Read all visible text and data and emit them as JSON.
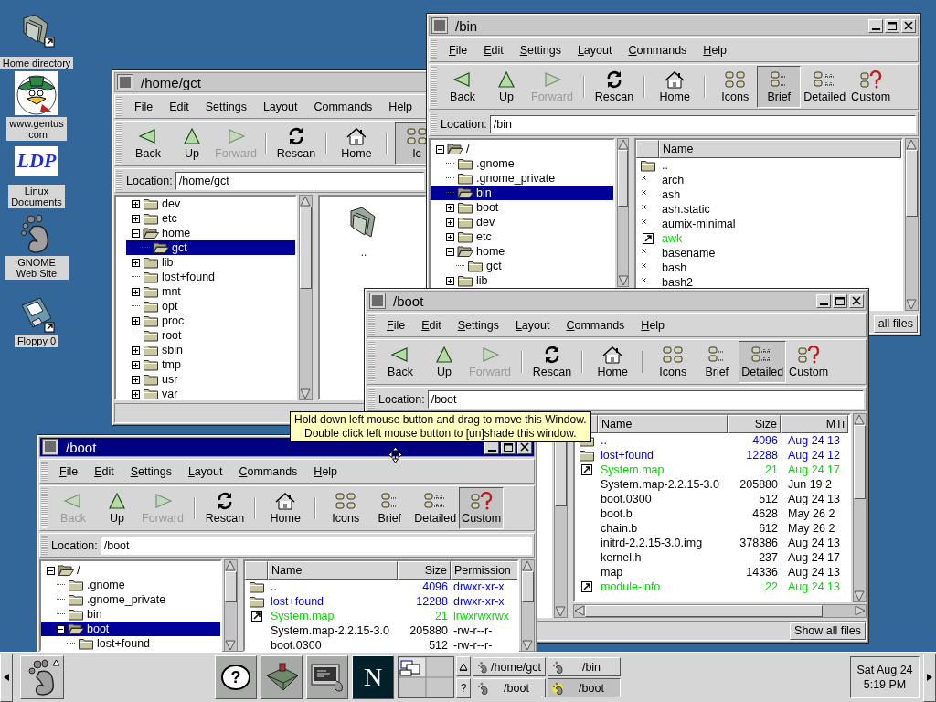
{
  "desktop_icons": [
    {
      "kind": "home-folder",
      "label": "Home directory"
    },
    {
      "kind": "cartoon",
      "label": "www.gentus.com"
    },
    {
      "kind": "logo",
      "logo_text": "LDP",
      "label": "Linux Documents"
    },
    {
      "kind": "foot",
      "label": "GNOME Web Site"
    },
    {
      "kind": "floppy",
      "label": "Floppy 0"
    }
  ],
  "windows": [
    {
      "title": "/home/gct",
      "active": false,
      "controls": false,
      "menu": [
        "File",
        "Edit",
        "Settings",
        "Layout",
        "Commands",
        "Help"
      ],
      "toolbar": [
        {
          "kind": "back",
          "label": "Back",
          "disabled": false,
          "selected": false
        },
        {
          "kind": "up",
          "label": "Up",
          "disabled": false,
          "selected": false
        },
        {
          "kind": "forward",
          "label": "Forward",
          "disabled": true,
          "selected": false
        },
        {
          "kind": "separator"
        },
        {
          "kind": "rescan",
          "label": "Rescan",
          "disabled": false,
          "selected": false
        },
        {
          "kind": "separator"
        },
        {
          "kind": "home",
          "label": "Home",
          "disabled": false,
          "selected": false
        },
        {
          "kind": "separator"
        },
        {
          "kind": "icons",
          "label": "Ic",
          "disabled": false,
          "selected": true
        }
      ],
      "location_label": "Location:",
      "location": "/home/gct",
      "tree": [
        {
          "label": "dev",
          "expandable": true,
          "expanded": false,
          "selected": false
        },
        {
          "label": "etc",
          "expandable": true,
          "expanded": false,
          "selected": false
        },
        {
          "label": "home",
          "expandable": true,
          "expanded": true,
          "selected": false,
          "children": [
            {
              "label": "gct",
              "expandable": false,
              "expanded": false,
              "selected": true
            }
          ]
        },
        {
          "label": "lib",
          "expandable": true,
          "expanded": false,
          "selected": false
        },
        {
          "label": "lost+found",
          "expandable": false,
          "expanded": false,
          "selected": false
        },
        {
          "label": "mnt",
          "expandable": true,
          "expanded": false,
          "selected": false
        },
        {
          "label": "opt",
          "expandable": false,
          "expanded": false,
          "selected": false
        },
        {
          "label": "proc",
          "expandable": true,
          "expanded": false,
          "selected": false
        },
        {
          "label": "root",
          "expandable": false,
          "expanded": false,
          "selected": false
        },
        {
          "label": "sbin",
          "expandable": true,
          "expanded": false,
          "selected": false
        },
        {
          "label": "tmp",
          "expandable": true,
          "expanded": false,
          "selected": false
        },
        {
          "label": "usr",
          "expandable": true,
          "expanded": false,
          "selected": false
        },
        {
          "label": "var",
          "expandable": true,
          "expanded": false,
          "selected": false
        }
      ],
      "list": {
        "kind": "icons",
        "items": [
          {
            "kind": "dir",
            "label": ".."
          }
        ]
      }
    },
    {
      "title": "/bin",
      "active": false,
      "controls": true,
      "menu": [
        "File",
        "Edit",
        "Settings",
        "Layout",
        "Commands",
        "Help"
      ],
      "toolbar": [
        {
          "kind": "back",
          "label": "Back",
          "disabled": false,
          "selected": false
        },
        {
          "kind": "up",
          "label": "Up",
          "disabled": false,
          "selected": false
        },
        {
          "kind": "forward",
          "label": "Forward",
          "disabled": true,
          "selected": false
        },
        {
          "kind": "separator"
        },
        {
          "kind": "rescan",
          "label": "Rescan",
          "disabled": false,
          "selected": false
        },
        {
          "kind": "separator"
        },
        {
          "kind": "home",
          "label": "Home",
          "disabled": false,
          "selected": false
        },
        {
          "kind": "separator"
        },
        {
          "kind": "icons",
          "label": "Icons",
          "disabled": false,
          "selected": false
        },
        {
          "kind": "brief",
          "label": "Brief",
          "disabled": false,
          "selected": true
        },
        {
          "kind": "detailed",
          "label": "Detailed",
          "disabled": false,
          "selected": false
        },
        {
          "kind": "custom",
          "label": "Custom",
          "disabled": false,
          "selected": false
        }
      ],
      "location_label": "Location:",
      "location": "/bin",
      "tree": [
        {
          "label": "/",
          "expandable": true,
          "expanded": true,
          "selected": false,
          "children": [
            {
              "label": ".gnome",
              "expandable": false,
              "expanded": false,
              "selected": false
            },
            {
              "label": ".gnome_private",
              "expandable": false,
              "expanded": false,
              "selected": false
            },
            {
              "label": "bin",
              "expandable": false,
              "expanded": false,
              "selected": true
            },
            {
              "label": "boot",
              "expandable": true,
              "expanded": false,
              "selected": false
            },
            {
              "label": "dev",
              "expandable": true,
              "expanded": false,
              "selected": false
            },
            {
              "label": "etc",
              "expandable": true,
              "expanded": false,
              "selected": false
            },
            {
              "label": "home",
              "expandable": true,
              "expanded": true,
              "selected": false,
              "children": [
                {
                  "label": "gct",
                  "expandable": false,
                  "expanded": false,
                  "selected": false
                }
              ]
            },
            {
              "label": "lib",
              "expandable": true,
              "expanded": false,
              "selected": false
            }
          ]
        }
      ],
      "list": {
        "kind": "brief",
        "columns": [
          {
            "kind": "name",
            "label": "Name"
          }
        ],
        "rows": [
          {
            "kind": "dir",
            "cells": [
              ".."
            ]
          },
          {
            "kind": "exec",
            "cells": [
              "arch"
            ]
          },
          {
            "kind": "exec",
            "cells": [
              "ash"
            ]
          },
          {
            "kind": "exec",
            "cells": [
              "ash.static"
            ]
          },
          {
            "kind": "exec",
            "cells": [
              "aumix-minimal"
            ]
          },
          {
            "kind": "link",
            "cells": [
              "awk"
            ]
          },
          {
            "kind": "exec",
            "cells": [
              "basename"
            ]
          },
          {
            "kind": "exec",
            "cells": [
              "bash"
            ]
          },
          {
            "kind": "exec",
            "cells": [
              "bash2"
            ]
          }
        ]
      },
      "status_button": "all files"
    },
    {
      "title": "/boot",
      "active": false,
      "controls": true,
      "menu": [
        "File",
        "Edit",
        "Settings",
        "Layout",
        "Commands",
        "Help"
      ],
      "toolbar": [
        {
          "kind": "back",
          "label": "Back",
          "disabled": false,
          "selected": false
        },
        {
          "kind": "up",
          "label": "Up",
          "disabled": false,
          "selected": false
        },
        {
          "kind": "forward",
          "label": "Forward",
          "disabled": true,
          "selected": false
        },
        {
          "kind": "separator"
        },
        {
          "kind": "rescan",
          "label": "Rescan",
          "disabled": false,
          "selected": false
        },
        {
          "kind": "separator"
        },
        {
          "kind": "home",
          "label": "Home",
          "disabled": false,
          "selected": false
        },
        {
          "kind": "separator"
        },
        {
          "kind": "icons",
          "label": "Icons",
          "disabled": false,
          "selected": false
        },
        {
          "kind": "brief",
          "label": "Brief",
          "disabled": false,
          "selected": false
        },
        {
          "kind": "detailed",
          "label": "Detailed",
          "disabled": false,
          "selected": true
        },
        {
          "kind": "custom",
          "label": "Custom",
          "disabled": false,
          "selected": false
        }
      ],
      "location_label": "Location:",
      "location": "/boot",
      "list": {
        "kind": "detailed",
        "columns": [
          {
            "kind": "name",
            "label": "Name"
          },
          {
            "kind": "size",
            "label": "Size"
          },
          {
            "kind": "mtime",
            "label": "MTi"
          }
        ],
        "rows": [
          {
            "kind": "dir",
            "cells": [
              "..",
              "4096",
              "Aug 24 13"
            ]
          },
          {
            "kind": "dir",
            "cells": [
              "lost+found",
              "12288",
              "Aug 24 12"
            ]
          },
          {
            "kind": "link",
            "cells": [
              "System.map",
              "21",
              "Aug 24 17"
            ]
          },
          {
            "kind": "file",
            "cells": [
              "System.map-2.2.15-3.0",
              "205880",
              "Jun 19 2"
            ]
          },
          {
            "kind": "file",
            "cells": [
              "boot.0300",
              "512",
              "Aug 24 13"
            ]
          },
          {
            "kind": "file",
            "cells": [
              "boot.b",
              "4628",
              "May 26 2"
            ]
          },
          {
            "kind": "file",
            "cells": [
              "chain.b",
              "612",
              "May 26 2"
            ]
          },
          {
            "kind": "file",
            "cells": [
              "initrd-2.2.15-3.0.img",
              "378386",
              "Aug 24 13"
            ]
          },
          {
            "kind": "file",
            "cells": [
              "kernel.h",
              "237",
              "Aug 24 17"
            ]
          },
          {
            "kind": "file",
            "cells": [
              "map",
              "14336",
              "Aug 24 13"
            ]
          },
          {
            "kind": "link",
            "cells": [
              "module-info",
              "22",
              "Aug 24 13"
            ]
          }
        ]
      },
      "status_button": "Show all files"
    },
    {
      "title": "/boot",
      "active": true,
      "controls": true,
      "menu": [
        "File",
        "Edit",
        "Settings",
        "Layout",
        "Commands",
        "Help"
      ],
      "toolbar": [
        {
          "kind": "back",
          "label": "Back",
          "disabled": true,
          "selected": false
        },
        {
          "kind": "up",
          "label": "Up",
          "disabled": false,
          "selected": false
        },
        {
          "kind": "forward",
          "label": "Forward",
          "disabled": true,
          "selected": false
        },
        {
          "kind": "separator"
        },
        {
          "kind": "rescan",
          "label": "Rescan",
          "disabled": false,
          "selected": false
        },
        {
          "kind": "separator"
        },
        {
          "kind": "home",
          "label": "Home",
          "disabled": false,
          "selected": false
        },
        {
          "kind": "separator"
        },
        {
          "kind": "icons",
          "label": "Icons",
          "disabled": false,
          "selected": false
        },
        {
          "kind": "brief",
          "label": "Brief",
          "disabled": false,
          "selected": false
        },
        {
          "kind": "detailed",
          "label": "Detailed",
          "disabled": false,
          "selected": false
        },
        {
          "kind": "custom",
          "label": "Custom",
          "disabled": false,
          "selected": true
        }
      ],
      "location_label": "Location:",
      "location": "/boot",
      "tree": [
        {
          "label": "/",
          "expandable": true,
          "expanded": true,
          "selected": false,
          "children": [
            {
              "label": ".gnome",
              "expandable": false,
              "expanded": false,
              "selected": false
            },
            {
              "label": ".gnome_private",
              "expandable": false,
              "expanded": false,
              "selected": false
            },
            {
              "label": "bin",
              "expandable": false,
              "expanded": false,
              "selected": false
            },
            {
              "label": "boot",
              "expandable": true,
              "expanded": true,
              "selected": true,
              "children": [
                {
                  "label": "lost+found",
                  "expandable": false,
                  "expanded": false,
                  "selected": false
                }
              ]
            }
          ]
        }
      ],
      "list": {
        "kind": "detailed",
        "columns": [
          {
            "kind": "name",
            "label": "Name"
          },
          {
            "kind": "size",
            "label": "Size"
          },
          {
            "kind": "permission",
            "label": "Permission"
          }
        ],
        "rows": [
          {
            "kind": "dir",
            "cells": [
              "..",
              "4096",
              "drwxr-xr-x"
            ]
          },
          {
            "kind": "dir",
            "cells": [
              "lost+found",
              "12288",
              "drwxr-xr-x"
            ]
          },
          {
            "kind": "link",
            "cells": [
              "System.map",
              "21",
              "lrwxrwxrwx"
            ]
          },
          {
            "kind": "file",
            "cells": [
              "System.map-2.2.15-3.0",
              "205880",
              "-rw-r--r-"
            ]
          },
          {
            "kind": "file",
            "cells": [
              "boot.0300",
              "512",
              "-rw-r--r-"
            ]
          }
        ]
      }
    }
  ],
  "tooltip": [
    "Hold down left mouse button and drag to move this Window.",
    "Double click left mouse button to [un]shade this window."
  ],
  "panel": {
    "launchers": [
      {
        "kind": "help",
        "glyph": "?"
      },
      {
        "kind": "toolbox"
      },
      {
        "kind": "terminal"
      },
      {
        "kind": "browser",
        "glyph": "N"
      }
    ],
    "applet_help": "?",
    "tasks": [
      {
        "label": "/home/gct",
        "selected": false
      },
      {
        "label": "/bin",
        "selected": false
      },
      {
        "label": "/boot",
        "selected": false
      },
      {
        "label": "/boot",
        "selected": true
      }
    ],
    "date": "Sat Aug 24",
    "time": "5:19 PM"
  }
}
